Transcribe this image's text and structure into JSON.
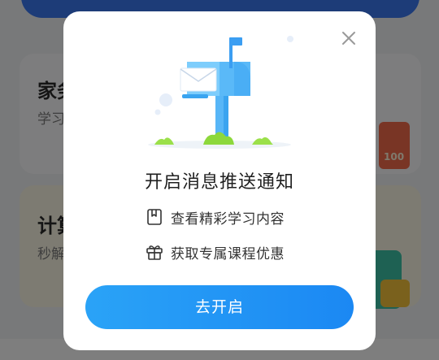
{
  "background": {
    "card1": {
      "title": "家务",
      "subtitle": "学习"
    },
    "card2": {
      "title": "计算",
      "subtitle": "秒解"
    },
    "deco_badge": "100"
  },
  "dialog": {
    "title": "开启消息推送通知",
    "features": [
      {
        "icon": "bookmark-icon",
        "label": "查看精彩学习内容"
      },
      {
        "icon": "gift-icon",
        "label": "获取专属课程优惠"
      }
    ],
    "button_label": "去开启",
    "close_icon": "close-icon",
    "illustration": "mailbox-illustration"
  },
  "colors": {
    "accent": "#1b8cf3",
    "overlay": "rgba(0,0,0,0.5)",
    "mailbox": "#6cc3fb"
  }
}
